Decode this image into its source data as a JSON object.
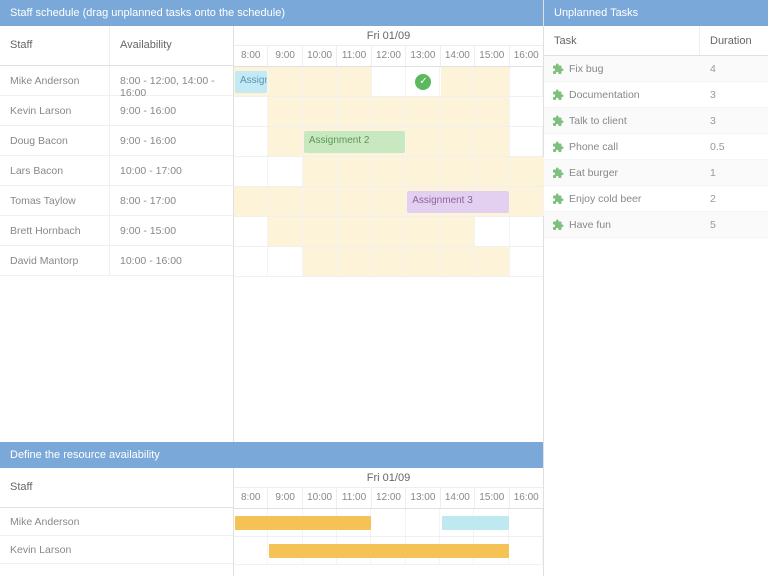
{
  "header_schedule": "Staff schedule (drag unplanned tasks onto the schedule)",
  "header_availability": "Define the resource availability",
  "header_tasks": "Unplanned Tasks",
  "date_label": "Fri 01/09",
  "col_staff": "Staff",
  "col_availability": "Availability",
  "col_task": "Task",
  "col_duration": "Duration",
  "hours": [
    "8:00",
    "9:00",
    "10:00",
    "11:00",
    "12:00",
    "13:00",
    "14:00",
    "15:00",
    "16:00"
  ],
  "staff": [
    {
      "name": "Mike Anderson",
      "availability": "8:00 - 12:00, 14:00 - 16:00",
      "avail_ranges": [
        [
          0,
          4
        ],
        [
          6,
          8
        ]
      ]
    },
    {
      "name": "Kevin Larson",
      "availability": "9:00 - 16:00",
      "avail_ranges": [
        [
          1,
          8
        ]
      ]
    },
    {
      "name": "Doug Bacon",
      "availability": "9:00 - 16:00",
      "avail_ranges": [
        [
          1,
          8
        ]
      ]
    },
    {
      "name": "Lars Bacon",
      "availability": "10:00 - 17:00",
      "avail_ranges": [
        [
          2,
          9
        ]
      ]
    },
    {
      "name": "Tomas Taylow",
      "availability": "8:00 - 17:00",
      "avail_ranges": [
        [
          0,
          9
        ]
      ]
    },
    {
      "name": "Brett Hornbach",
      "availability": "9:00 - 15:00",
      "avail_ranges": [
        [
          1,
          7
        ]
      ]
    },
    {
      "name": "David Mantorp",
      "availability": "10:00 - 16:00",
      "avail_ranges": [
        [
          2,
          8
        ]
      ]
    }
  ],
  "assignments": [
    {
      "row": 0,
      "label": "Assign",
      "start": 0,
      "span": 1,
      "theme": "blue"
    },
    {
      "row": 2,
      "label": "Assignment 2",
      "start": 2,
      "span": 3,
      "theme": "green"
    },
    {
      "row": 4,
      "label": "Assignment 3",
      "start": 5,
      "span": 3,
      "theme": "purple"
    }
  ],
  "check_badge": {
    "row": 0,
    "col": 5
  },
  "tasks": [
    {
      "name": "Fix bug",
      "duration": "4"
    },
    {
      "name": "Documentation",
      "duration": "3"
    },
    {
      "name": "Talk to client",
      "duration": "3"
    },
    {
      "name": "Phone call",
      "duration": "0.5"
    },
    {
      "name": "Eat burger",
      "duration": "1"
    },
    {
      "name": "Enjoy cold beer",
      "duration": "2"
    },
    {
      "name": "Have fun",
      "duration": "5"
    }
  ],
  "avail_staff": [
    {
      "name": "Mike Anderson",
      "bars": [
        {
          "start": 0,
          "span": 4,
          "color": "yellow"
        },
        {
          "start": 6,
          "span": 2,
          "color": "teal"
        }
      ]
    },
    {
      "name": "Kevin Larson",
      "bars": [
        {
          "start": 1,
          "span": 7,
          "color": "yellow"
        }
      ]
    }
  ],
  "colors": {
    "header": "#7aa9d9",
    "avail_bg": "#fdf3d9",
    "bar_yellow": "#f5c256",
    "bar_teal": "#bfe9f0",
    "blue": "#c3e9f5",
    "green": "#c7e8c0",
    "purple": "#e3d0f0",
    "puzzle": "#7ec17e"
  }
}
